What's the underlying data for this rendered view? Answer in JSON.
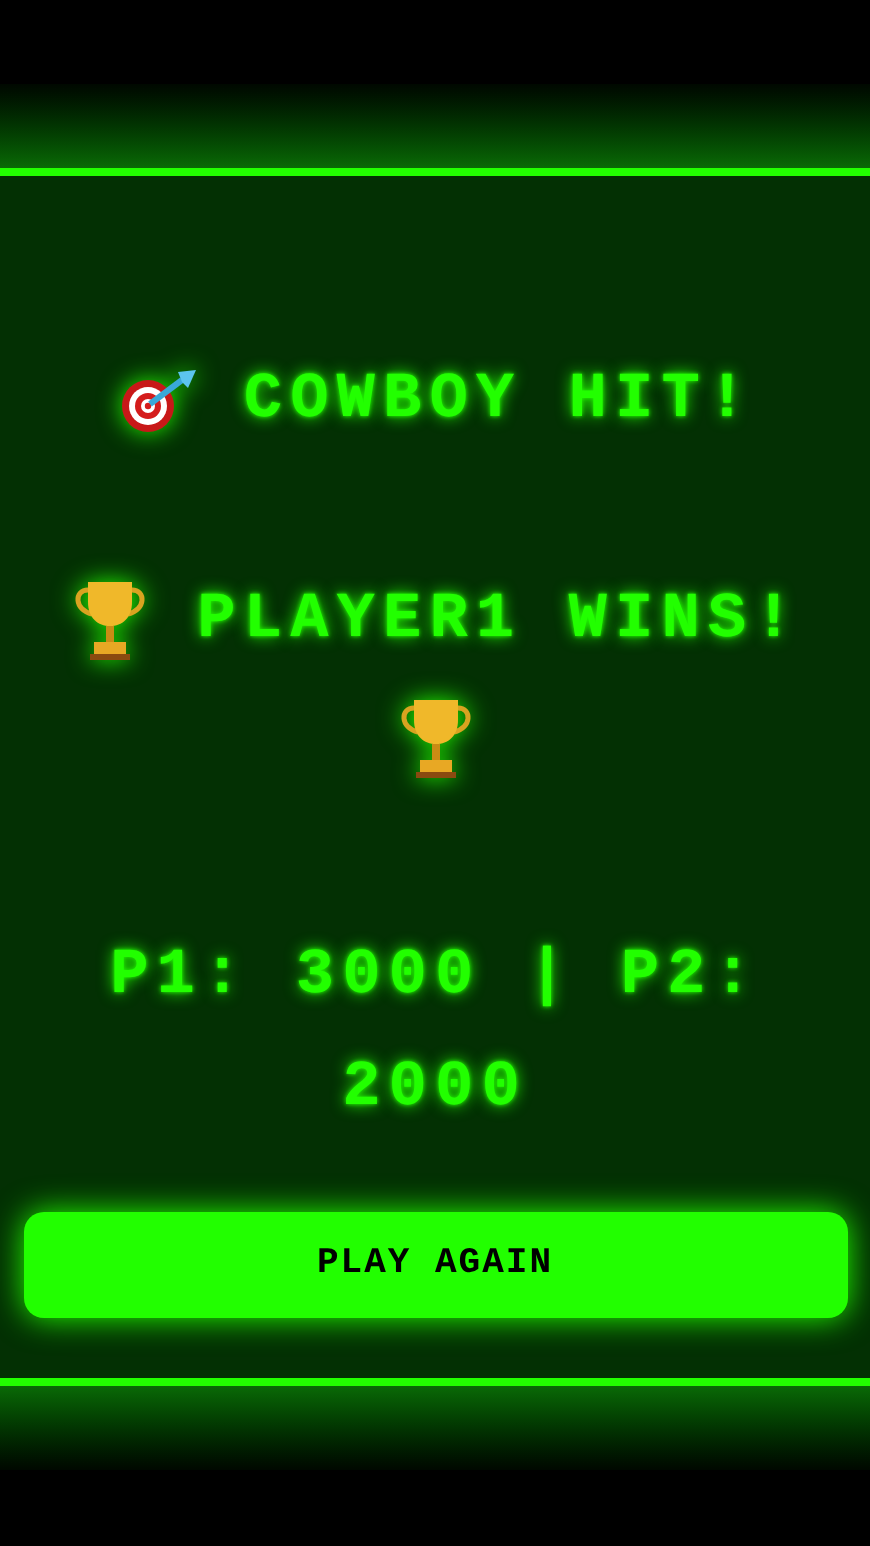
{
  "hit_message": "COWBOY HIT!",
  "winner_message": "PLAYER1 WINS!",
  "score": "P1: 3000 | P2: 2000",
  "button": "PLAY AGAIN"
}
